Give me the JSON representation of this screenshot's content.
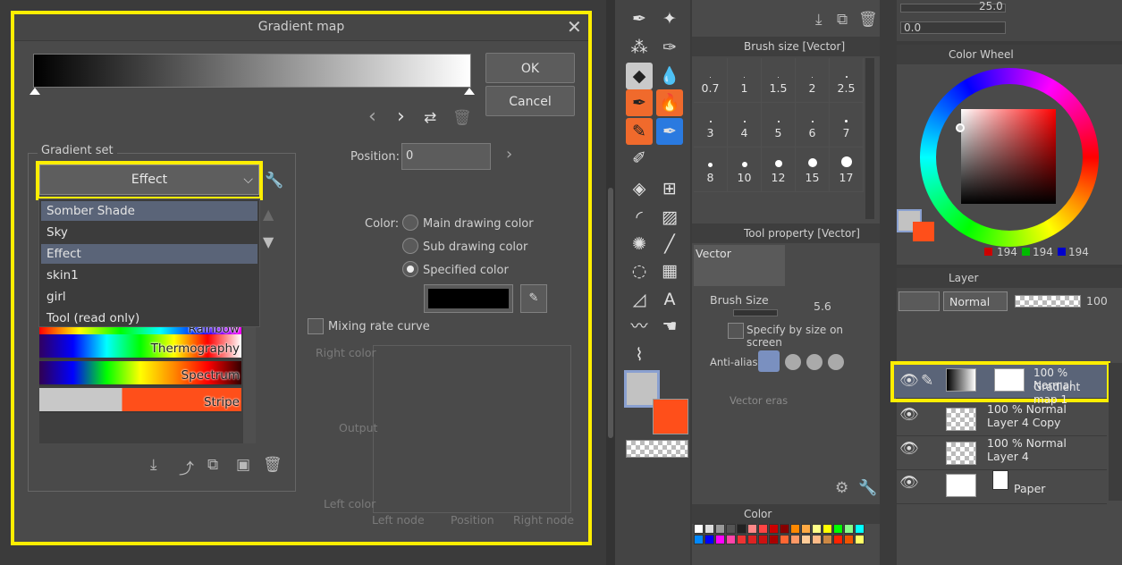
{
  "dialog": {
    "title": "Gradient map",
    "close": "✕",
    "ok_label": "OK",
    "cancel_label": "Cancel",
    "gradient_set_label": "Gradient set",
    "selected_set": "Effect",
    "set_options": [
      "Somber Shade",
      "Sky",
      "Effect",
      "skin1",
      "girl",
      "Tool (read only)"
    ],
    "gradients": [
      "Rainbow",
      "Thermography",
      "Spectrum",
      "Stripe"
    ],
    "position_label": "Position:",
    "position_value": "0",
    "color_label": "Color:",
    "color_options": [
      "Main drawing color",
      "Sub drawing color",
      "Specified color"
    ],
    "selected_color_option": "Specified color",
    "specified_color": "#000000",
    "mixing_rate_curve": "Mixing rate curve",
    "curve_right_color": "Right color",
    "curve_output": "Output",
    "curve_left_color": "Left color",
    "curve_axis_labels": [
      "Left node",
      "Position",
      "Right node"
    ]
  },
  "brush_size_panel": {
    "title": "Brush size [Vector]",
    "sizes": [
      "0.7",
      "1",
      "1.5",
      "2",
      "2.5",
      "3",
      "4",
      "5",
      "6",
      "7",
      "8",
      "10",
      "12",
      "15",
      "17"
    ]
  },
  "tool_property": {
    "title": "Tool property [Vector]",
    "tool_name": "Vector",
    "brush_size_label": "Brush Size",
    "brush_size_value": "5.6",
    "specify_by_size": "Specify by size on screen",
    "anti_aliasing": "Anti-aliasin",
    "vector_erase": "Vector eras"
  },
  "top_slider": {
    "value1": "25.0",
    "value2": "0.0"
  },
  "color_wheel": {
    "title": "Color Wheel",
    "r": "194",
    "g": "194",
    "b": "194",
    "main_color": "#c2c2c2",
    "sub_color": "#ff4f1a"
  },
  "color_panel": {
    "title": "Color"
  },
  "layer_panel": {
    "title": "Layer",
    "blend_mode": "Normal",
    "opacity": "100",
    "layers": [
      {
        "mode": "100 % Normal",
        "name": "Gradient map 1"
      },
      {
        "mode": "100 % Normal",
        "name": "Layer 4 Copy"
      },
      {
        "mode": "100 % Normal",
        "name": "Layer 4"
      },
      {
        "mode": "",
        "name": "Paper"
      }
    ]
  }
}
